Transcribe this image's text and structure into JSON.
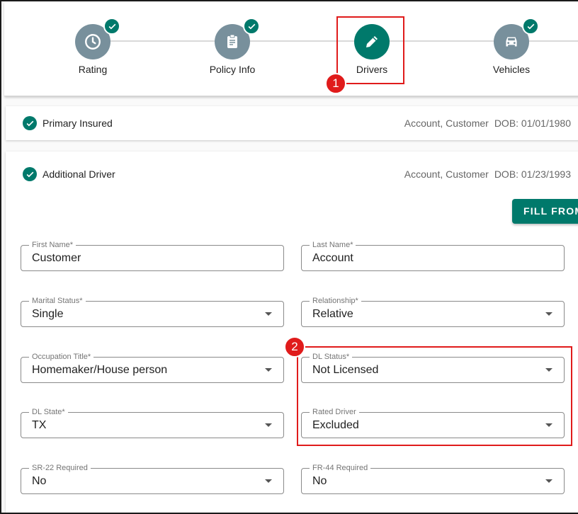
{
  "stepper": {
    "steps": [
      {
        "label": "Rating",
        "icon": "clock-icon",
        "completed": true
      },
      {
        "label": "Policy Info",
        "icon": "clipboard-icon",
        "completed": true
      },
      {
        "label": "Drivers",
        "icon": "pencil-icon",
        "active": true
      },
      {
        "label": "Vehicles",
        "icon": "car-icon",
        "completed": true
      }
    ]
  },
  "callouts": {
    "one": "1",
    "two": "2"
  },
  "primary": {
    "title": "Primary Insured",
    "name": "Account, Customer",
    "dob": "DOB: 01/01/1980"
  },
  "additional": {
    "title": "Additional Driver",
    "name": "Account, Customer",
    "dob": "DOB: 01/23/1993",
    "fill_button": "FILL FROM"
  },
  "fields": {
    "first_name": {
      "label": "First Name*",
      "value": "Customer"
    },
    "last_name": {
      "label": "Last Name*",
      "value": "Account"
    },
    "marital_status": {
      "label": "Marital Status*",
      "value": "Single"
    },
    "relationship": {
      "label": "Relationship*",
      "value": "Relative"
    },
    "occupation": {
      "label": "Occupation Title*",
      "value": "Homemaker/House person"
    },
    "dl_status": {
      "label": "DL Status*",
      "value": "Not Licensed"
    },
    "dl_state": {
      "label": "DL State*",
      "value": "TX"
    },
    "rated_driver": {
      "label": "Rated Driver",
      "value": "Excluded"
    },
    "sr22": {
      "label": "SR-22 Required",
      "value": "No"
    },
    "fr44": {
      "label": "FR-44 Required",
      "value": "No"
    }
  },
  "colors": {
    "accent": "#00796b",
    "inactive_step": "#78909c",
    "callout": "#e01b1b"
  }
}
